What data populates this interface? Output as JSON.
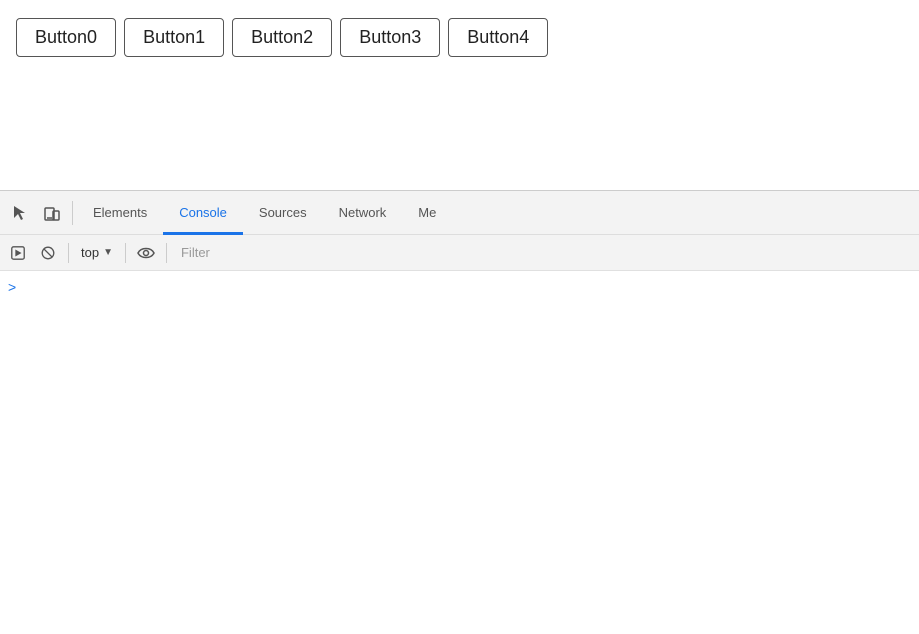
{
  "page": {
    "buttons": [
      {
        "label": "Button0"
      },
      {
        "label": "Button1"
      },
      {
        "label": "Button2"
      },
      {
        "label": "Button3"
      },
      {
        "label": "Button4"
      }
    ]
  },
  "devtools": {
    "tabs": [
      {
        "label": "Elements",
        "active": false
      },
      {
        "label": "Console",
        "active": true
      },
      {
        "label": "Sources",
        "active": false
      },
      {
        "label": "Network",
        "active": false
      },
      {
        "label": "Me",
        "active": false
      }
    ],
    "console": {
      "context_label": "top",
      "filter_placeholder": "Filter",
      "prompt_symbol": ">"
    }
  }
}
